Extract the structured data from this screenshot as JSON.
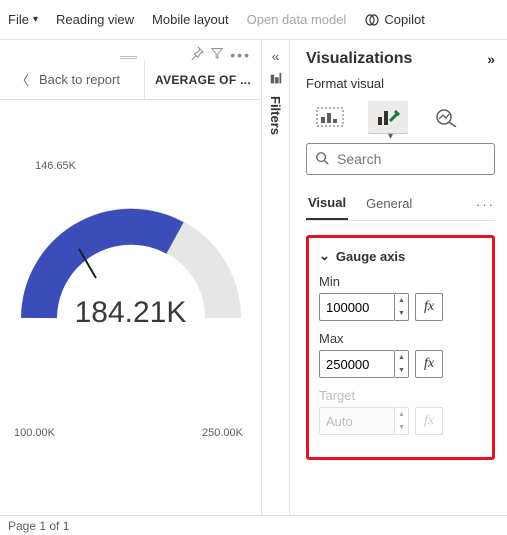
{
  "menu": {
    "file": "File",
    "reading_view": "Reading view",
    "mobile_layout": "Mobile layout",
    "open_data_model": "Open data model",
    "copilot": "Copilot"
  },
  "canvas": {
    "back_label": "Back to report",
    "header_metric": "AVERAGE OF ..."
  },
  "filters_rail": {
    "label": "Filters"
  },
  "viz": {
    "title": "Visualizations",
    "format_visual": "Format visual",
    "search_placeholder": "Search",
    "tabs": {
      "visual": "Visual",
      "general": "General"
    },
    "accordion": {
      "gauge_axis": "Gauge axis",
      "min_label": "Min",
      "min_value": "100000",
      "max_label": "Max",
      "max_value": "250000",
      "target_label": "Target",
      "target_value": "Auto",
      "fx": "fx"
    }
  },
  "footer": {
    "page": "Page 1 of 1"
  },
  "chart_data": {
    "type": "gauge",
    "value": 184210,
    "value_display": "184.21K",
    "min": 100000,
    "min_display": "100.00K",
    "max": 250000,
    "max_display": "250.00K",
    "marker": 146650,
    "marker_display": "146.65K",
    "fill_color": "#3b4db8",
    "empty_color": "#e6e6e6"
  }
}
